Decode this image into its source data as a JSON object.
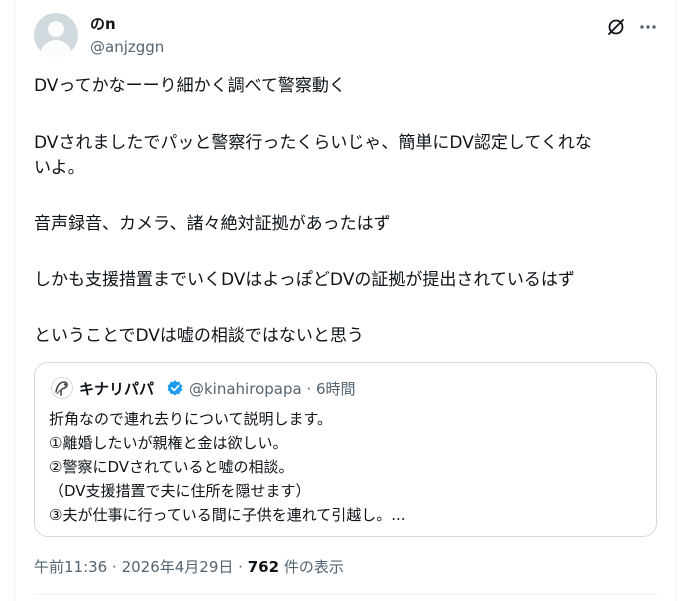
{
  "author": {
    "display_name": "のn",
    "handle": "@anjzggn"
  },
  "icons": {
    "avatar": "default-avatar",
    "grok": "grok-icon",
    "more": "more-horizontal-icon"
  },
  "tweet": {
    "paragraphs": [
      "DVってかなーーり細かく調べて警察動く",
      "DVされましたでパッと警察行ったくらいじゃ、簡単にDV認定してくれな\nいよ。",
      "音声録音、カメラ、諸々絶対証拠があったはず",
      "しかも支援措置までいくDVはよっぽどDVの証拠が提出されているはず",
      "ということでDVは嘘の相談ではないと思う"
    ]
  },
  "quote": {
    "name": "キナリパパ",
    "verified": true,
    "handle": "@kinahiropapa",
    "separator": "·",
    "time": "6時間",
    "lines": [
      "折角なので連れ去りについて説明します。",
      "①離婚したいが親権と金は欲しい。",
      "②警察にDVされていると嘘の相談。",
      "（DV支援措置で夫に住所を隠せます）",
      "③夫が仕事に行っている間に子供を連れて引越し。..."
    ]
  },
  "meta": {
    "time": "午前11:36",
    "sep1": "·",
    "date": "2026年4月29日",
    "sep2": "·",
    "views_count": "762",
    "views_label": "件の表示"
  },
  "colors": {
    "text": "#0f1419",
    "secondary": "#536471",
    "border": "#cfd9de",
    "verified": "#1d9bf0"
  }
}
